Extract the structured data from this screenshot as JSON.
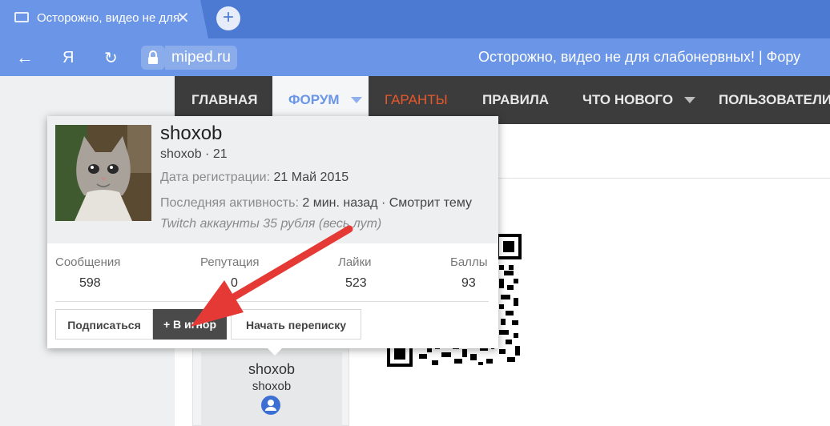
{
  "browser": {
    "tab_title": "Осторожно, видео не для",
    "tab_close": "✕",
    "newtab_label": "+",
    "back_glyph": "←",
    "yandex_glyph": "Я",
    "reload_glyph": "↻",
    "domain": "miped.ru",
    "page_title": "Осторожно, видео не для слабонервных! | Фору"
  },
  "nav": {
    "items": [
      {
        "label": "ГЛАВНАЯ"
      },
      {
        "label": "ФОРУМ"
      },
      {
        "label": "ГАРАНТЫ"
      },
      {
        "label": "ПРАВИЛА"
      },
      {
        "label": "ЧТО НОВОГО"
      },
      {
        "label": "ПОЛЬЗОВАТЕЛИ"
      }
    ],
    "active_color": "#6b95e6",
    "highlight_color": "#e8582b"
  },
  "card": {
    "username": "shoxob",
    "subtitle": "shoxob · 21",
    "reg_label": "Дата регистрации:",
    "reg_value": "21 Май 2015",
    "activity_label": "Последняя активность:",
    "activity_value": "2 мин. назад · Смотрит тему",
    "status": "Twitch аккаунты 35 рубля (весь лут)",
    "stats": [
      {
        "label": "Сообщения",
        "value": "598"
      },
      {
        "label": "Репутация",
        "value": "0"
      },
      {
        "label": "Лайки",
        "value": "523"
      },
      {
        "label": "Баллы",
        "value": "93"
      }
    ],
    "buttons": {
      "follow": "Подписаться",
      "ignore": "+ В игнор",
      "conversation": "Начать переписку"
    }
  },
  "postbit": {
    "name": "shoxob",
    "title": "shoxob"
  },
  "annotation": {
    "arrow_color": "#e53935"
  }
}
